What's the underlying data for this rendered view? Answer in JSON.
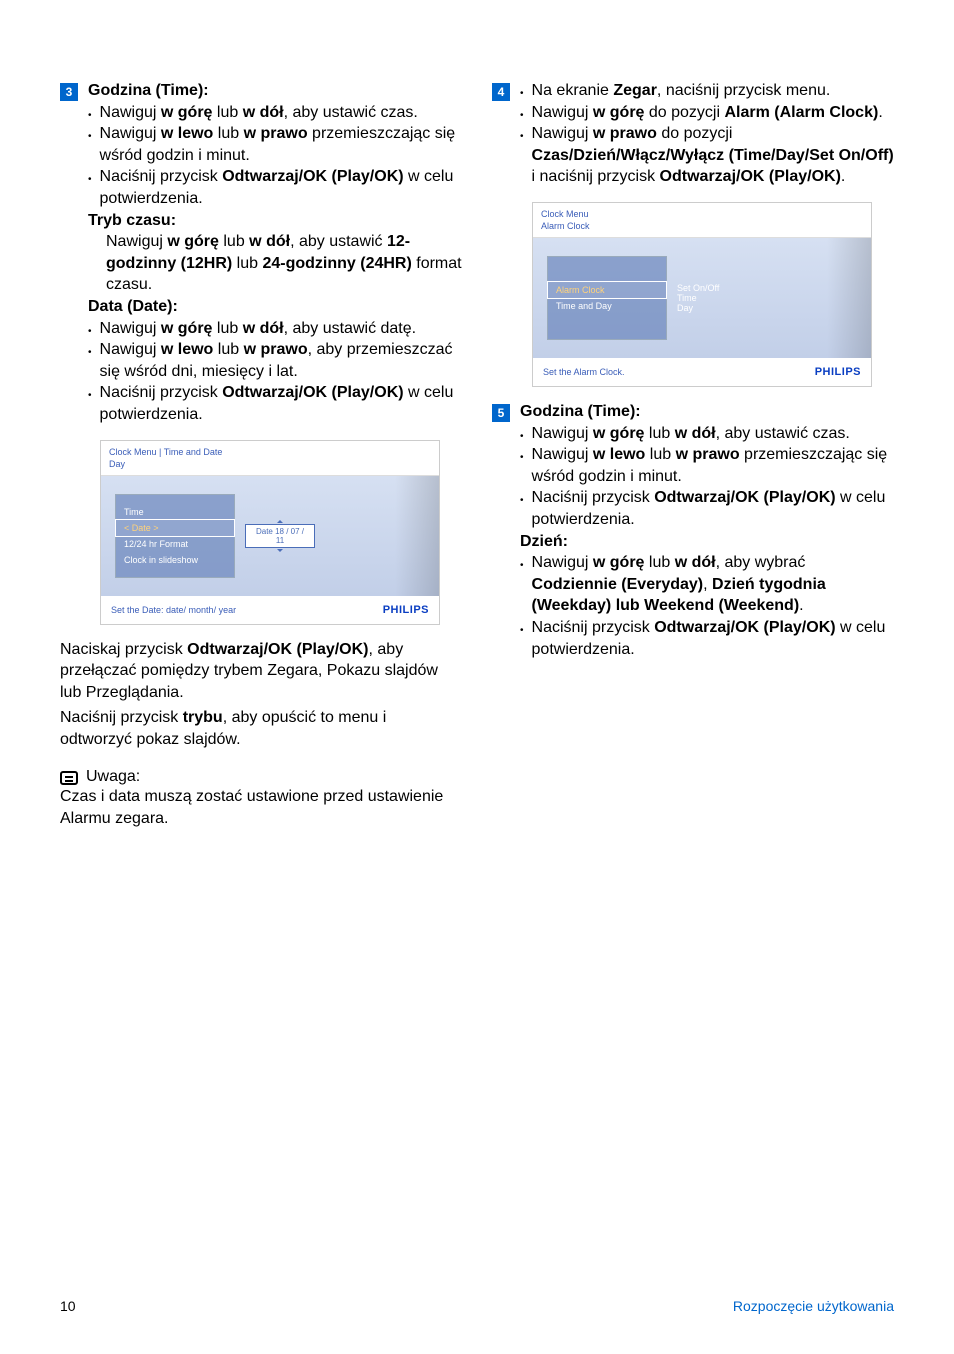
{
  "left": {
    "step3": {
      "num": "3",
      "title_b": "Godzina (Time):",
      "g1_1a": "Nawiguj ",
      "g1_1b": "w górę",
      "g1_1c": " lub ",
      "g1_1d": "w dół",
      "g1_1e": ", aby ustawić czas.",
      "g2_1a": "Nawiguj ",
      "g2_1b": "w lewo",
      "g2_1c": " lub ",
      "g2_1d": "w prawo",
      "g2_2": " przemieszczając się wśród godzin i minut.",
      "g3_1a": "Naciśnij przycisk ",
      "g3_1b": "Odtwarzaj/OK (Play/OK)",
      "g3_1c": " w celu potwierdzenia.",
      "tryb_title": "Tryb czasu:",
      "tryb_a": "Nawiguj ",
      "tryb_b": "w górę",
      "tryb_c": " lub ",
      "tryb_d": "w dół",
      "tryb_e": ", aby ustawić ",
      "tryb_f": "12-godzinny (12HR)",
      "tryb_g": " lub ",
      "tryb_h": "24-godzinny (24HR)",
      "tryb_i": " format czasu.",
      "data_title": "Data (Date):",
      "d1_a": "Nawiguj ",
      "d1_b": "w górę",
      "d1_c": " lub ",
      "d1_d": "w dół",
      "d1_e": ", aby ustawić datę.",
      "d2_a": "Nawiguj ",
      "d2_b": "w lewo",
      "d2_c": " lub ",
      "d2_d": "w prawo",
      "d2_e": ", aby przemieszczać się wśród dni, miesięcy i lat.",
      "d3_a": "Naciśnij przycisk ",
      "d3_b": "Odtwarzaj/OK (Play/OK)",
      "d3_c": "  w celu potwierdzenia."
    },
    "shot1": {
      "crumb": "Clock Menu | Time and Date",
      "sub": "Day",
      "m1": "Time",
      "m2": "< Date >",
      "m3": "12/24 hr Format",
      "m4": "Clock in slideshow",
      "val": "Date 18 / 07 / 11",
      "footer": "Set the Date: date/ month/ year",
      "brand": "PHILIPS"
    },
    "para1_a": "Naciskaj przycisk ",
    "para1_b": "Odtwarzaj/OK (Play/OK)",
    "para1_c": ", aby przełączać pomiędzy trybem Zegara, Pokazu slajdów lub Przeglądania.",
    "para2_a": "Naciśnij przycisk ",
    "para2_b": "trybu",
    "para2_c": ", aby opuścić to menu i odtworzyć pokaz slajdów.",
    "note_label": "Uwaga:",
    "note_text": "Czas i data muszą zostać ustawione przed ustawienie Alarmu zegara."
  },
  "right": {
    "step4": {
      "num": "4",
      "l1_a": "Na ekranie ",
      "l1_b": "Zegar",
      "l1_c": ", naciśnij przycisk menu.",
      "l2_a": "Nawiguj ",
      "l2_b": "w górę",
      "l2_c": " do pozycji ",
      "l2_d": "Alarm (Alarm Clock)",
      "l2_e": ".",
      "l3_a": "Nawiguj ",
      "l3_b": "w prawo",
      "l3_c": " do pozycji ",
      "l3_d": "Czas/Dzień/Włącz/Wyłącz (Time/Day/Set On/Off)",
      "l3_e": " i naciśnij przycisk ",
      "l3_f": "Odtwarzaj/OK (Play/OK)",
      "l3_g": "."
    },
    "shot2": {
      "crumb": "Clock Menu",
      "sub": "Alarm Clock",
      "m1": "Alarm Clock",
      "m2": "Time and Day",
      "r1": "Set On/Off",
      "r2": "Time",
      "r3": "Day",
      "footer": "Set the Alarm Clock.",
      "brand": "PHILIPS"
    },
    "step5": {
      "num": "5",
      "title_b": "Godzina (Time):",
      "g1_a": "Nawiguj ",
      "g1_b": "w górę",
      "g1_c": " lub ",
      "g1_d": "w dół",
      "g1_e": ", aby ustawić czas.",
      "g2_a": "Nawiguj ",
      "g2_b": "w lewo",
      "g2_c": " lub ",
      "g2_d": "w prawo",
      "g2_e": " przemieszczając się wśród godzin i minut.",
      "g3_a": "Naciśnij przycisk ",
      "g3_b": "Odtwarzaj/OK (Play/OK)",
      "g3_c": " w celu potwierdzenia.",
      "dzien_title": "Dzień:",
      "dz1_a": "Nawiguj ",
      "dz1_b": "w górę",
      "dz1_c": " lub ",
      "dz1_d": "w dół",
      "dz1_e": ", aby wybrać ",
      "dz1_f": "Codziennie (Everyday)",
      "dz1_g": ", ",
      "dz1_h": "Dzień tygodnia (Weekday) lub Weekend (Weekend)",
      "dz1_i": ".",
      "dz2_a": "Naciśnij przycisk ",
      "dz2_b": "Odtwarzaj/OK (Play/OK)",
      "dz2_c": " w celu potwierdzenia."
    }
  },
  "footer": {
    "page": "10",
    "section": "Rozpoczęcie użytkowania"
  }
}
